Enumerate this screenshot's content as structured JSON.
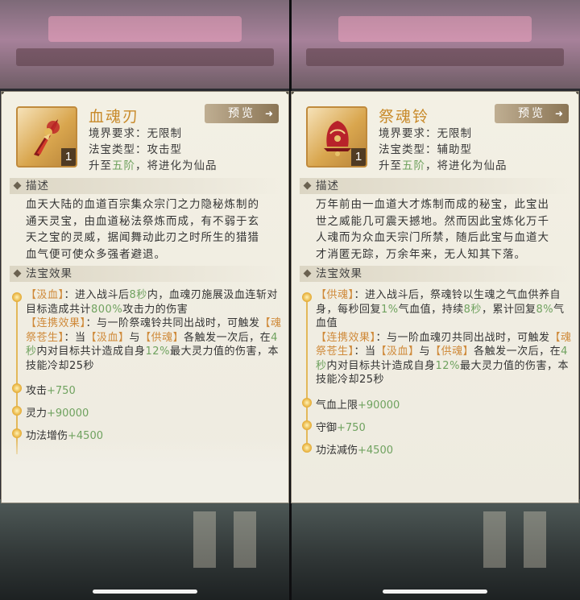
{
  "cards": [
    {
      "name": "血魂刃",
      "level": "1",
      "preview_label": "预览",
      "preview_arrow": "➜",
      "realm_label": "境界要求：",
      "realm_value": "无限制",
      "type_label": "法宝类型：",
      "type_value": "攻击型",
      "upgrade_prefix": "升至",
      "upgrade_stage": "五阶",
      "upgrade_suffix": "，将进化为仙品",
      "desc_header": "描述",
      "desc_lines": [
        "血天大陆的血道百宗集众宗门之力隐秘炼制的",
        "通天灵宝，由血道秘法祭炼而成，有不弱于玄",
        "天之宝的灵威，据闻舞动此刃之时所生的猎猎",
        "血气便可使众多强者避退。"
      ],
      "effect_header": "法宝效果",
      "effect1_tag": "【汲血】",
      "effect1_a": "：进入战斗后",
      "effect1_sec": "8秒",
      "effect1_b": "内，血魂刃施展汲血连斩对目标造成共计",
      "effect1_pct": "800%",
      "effect1_c": "攻击力的伤害",
      "combo_tag": "【连携效果】",
      "combo_a": "：与一阶祭魂铃共同出战时，可触发",
      "combo_name": "【魂祭苍生】",
      "combo_b": "：当",
      "combo_t1": "【汲血】",
      "combo_and": "与",
      "combo_t2": "【供魂】",
      "combo_c": "各触发一次后，在",
      "combo_sec": "4秒",
      "combo_d": "内对目标共计造成自身",
      "combo_pct": "12%",
      "combo_e": "最大灵力值的伤害，本技能冷却25秒",
      "stats": [
        {
          "label": "攻击",
          "value": "+750"
        },
        {
          "label": "灵力",
          "value": "+90000"
        },
        {
          "label": "功法增伤",
          "value": "+4500"
        }
      ]
    },
    {
      "name": "祭魂铃",
      "level": "1",
      "preview_label": "预览",
      "preview_arrow": "➜",
      "realm_label": "境界要求：",
      "realm_value": "无限制",
      "type_label": "法宝类型：",
      "type_value": "辅助型",
      "upgrade_prefix": "升至",
      "upgrade_stage": "五阶",
      "upgrade_suffix": "，将进化为仙品",
      "desc_header": "描述",
      "desc_lines": [
        "万年前由一血道大才炼制而成的秘宝，此宝出",
        "世之威能几可震天撼地。然而因此宝炼化万千",
        "人魂而为众血天宗门所禁，随后此宝与血道大",
        "才消匿无踪，万余年来，无人知其下落。"
      ],
      "effect_header": "法宝效果",
      "effect1_tag": "【供魂】",
      "effect1_a": "：进入战斗后，祭魂铃以生魂之气血供养自身，每秒回复",
      "effect1_pct": "1%",
      "effect1_b": "气血值，持续",
      "effect1_sec": "8秒",
      "effect1_c": "，累计回复",
      "effect1_pct2": "8%",
      "effect1_d": "气血值",
      "combo_tag": "【连携效果】",
      "combo_a": "：与一阶血魂刃共同出战时，可触发",
      "combo_name": "【魂祭苍生】",
      "combo_b": "：当",
      "combo_t1": "【汲血】",
      "combo_and": "与",
      "combo_t2": "【供魂】",
      "combo_c": "各触发一次后，在",
      "combo_sec": "4秒",
      "combo_d": "内对目标共计造成自身",
      "combo_pct": "12%",
      "combo_e": "最大灵力值的伤害，本技能冷却25秒",
      "stats": [
        {
          "label": "气血上限",
          "value": "+90000"
        },
        {
          "label": "守御",
          "value": "+750"
        },
        {
          "label": "功法减伤",
          "value": "+4500"
        }
      ]
    }
  ]
}
